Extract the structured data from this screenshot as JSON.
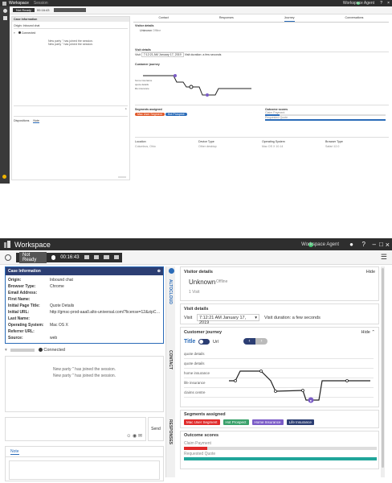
{
  "app": {
    "title": "Workspace",
    "small_tab": "Session",
    "user_badge": "Workspace Agent",
    "help": "?",
    "min": "–",
    "max": "□",
    "close": "×"
  },
  "toolbar": {
    "status": "Not Ready",
    "timer": "00:16:43"
  },
  "case_info": {
    "title": "Case Information",
    "rows": [
      {
        "k": "Origin:",
        "v": "Inbound chat"
      },
      {
        "k": "Browser Type:",
        "v": "Chrome"
      },
      {
        "k": "Email Address:",
        "v": ""
      },
      {
        "k": "First Name:",
        "v": ""
      },
      {
        "k": "Initial Page Title:",
        "v": "Quote Details"
      },
      {
        "k": "Initial URL:",
        "v": "http://gmsc-prod-aaa0.alto-universal.com/?license=12&zipCode=12..."
      },
      {
        "k": "Last Name:",
        "v": ""
      },
      {
        "k": "Operating System:",
        "v": "Mac OS X"
      },
      {
        "k": "Referrer URL:",
        "v": ""
      },
      {
        "k": "Source:",
        "v": "web"
      }
    ]
  },
  "chat": {
    "connected": "Connected",
    "messages": [
      "New party '' has joined the session.",
      "New party '' has joined the session."
    ],
    "send": "Send",
    "tab_dispositions": "Dispositions",
    "tab_note": "Note",
    "side_altocloud": "ALTOCLOUD",
    "side_contact": "CONTACT",
    "side_responses": "RESPONSES"
  },
  "top_tabs": {
    "contact": "Contact",
    "responses": "Responses",
    "journey": "Journey",
    "conversations": "Conversations"
  },
  "visitor": {
    "section": "Visitor details",
    "hide": "Hide",
    "name": "Unknown",
    "status": "Offline",
    "visits": "1 Visit"
  },
  "visit": {
    "section": "Visit details",
    "label": "Visit",
    "date": "7:12:21 AM January 17, 2019",
    "duration": "Visit duration: a few seconds"
  },
  "journey": {
    "section": "Customer journey",
    "hide": "Hide",
    "title_label": "Title",
    "url_label": "Url",
    "rows": [
      "quote details",
      "quote details",
      "home insurance",
      "life insurance",
      "claims centre"
    ]
  },
  "segments": {
    "section": "Segments assigned",
    "items": [
      {
        "label": "Mac User Segment",
        "color": "#e02b2b"
      },
      {
        "label": "Hot Prospect",
        "color": "#3aa16b"
      },
      {
        "label": "Home Insurance",
        "color": "#7b5cc7"
      },
      {
        "label": "Life Insurance",
        "color": "#2c3e73"
      }
    ]
  },
  "outcomes": {
    "section": "Outcome scores",
    "items": [
      {
        "label": "Claim Payment",
        "fraction": 0.12,
        "color": "#e02b2b"
      },
      {
        "label": "Requested Quote",
        "fraction": 1.0,
        "color": "#20a59a"
      }
    ]
  },
  "device": {
    "headers": [
      "Location",
      "Device Type",
      "Operating System",
      "Browser Type"
    ],
    "values": [
      "Columbus, Ohio",
      "Other desktop",
      "Mac OS X 10.14",
      "Safari 12.0"
    ]
  },
  "colors": {
    "case_header": "#2c3e73",
    "titlebar": "#2e2e2e",
    "accent_blue": "#2a6bb8"
  }
}
